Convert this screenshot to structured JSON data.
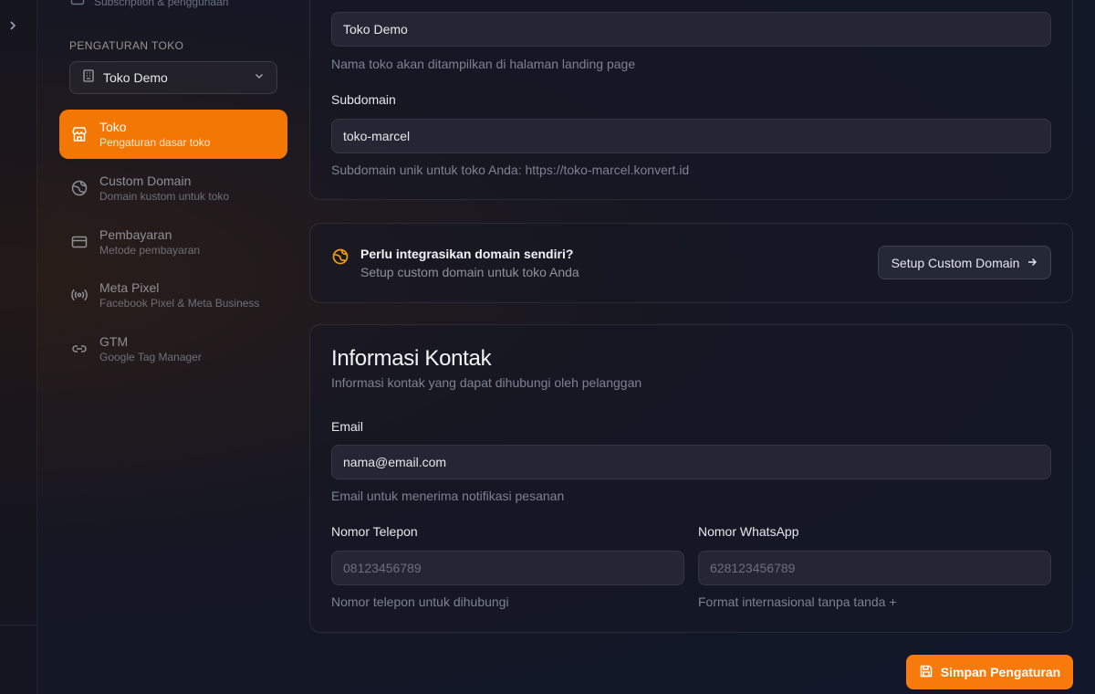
{
  "sidebar": {
    "top_item": {
      "subtitle": "Subscription & penggunaan"
    },
    "section_label": "PENGATURAN TOKO",
    "store_select": {
      "value": "Toko Demo"
    },
    "items": [
      {
        "title": "Toko",
        "subtitle": "Pengaturan dasar toko",
        "icon": "store-icon",
        "active": true
      },
      {
        "title": "Custom Domain",
        "subtitle": "Domain kustom untuk toko",
        "icon": "globe-icon"
      },
      {
        "title": "Pembayaran",
        "subtitle": "Metode pembayaran",
        "icon": "credit-card-icon"
      },
      {
        "title": "Meta Pixel",
        "subtitle": "Facebook Pixel & Meta Business",
        "icon": "radio-icon"
      },
      {
        "title": "GTM",
        "subtitle": "Google Tag Manager",
        "icon": "link-icon"
      }
    ]
  },
  "store_card": {
    "name_value": "Toko Demo",
    "name_help": "Nama toko akan ditampilkan di halaman landing page",
    "subdomain_label": "Subdomain",
    "subdomain_value": "toko-marcel",
    "subdomain_help": "Subdomain unik untuk toko Anda: https://toko-marcel.konvert.id"
  },
  "domain_cta": {
    "title": "Perlu integrasikan domain sendiri?",
    "subtitle": "Setup custom domain untuk toko Anda",
    "button_label": "Setup Custom Domain"
  },
  "contact_card": {
    "title": "Informasi Kontak",
    "subtitle": "Informasi kontak yang dapat dihubungi oleh pelanggan",
    "email_label": "Email",
    "email_value": "nama@email.com",
    "email_help": "Email untuk menerima notifikasi pesanan",
    "phone_label": "Nomor Telepon",
    "phone_placeholder": "08123456789",
    "phone_help": "Nomor telepon untuk dihubungi",
    "whatsapp_label": "Nomor WhatsApp",
    "whatsapp_placeholder": "628123456789",
    "whatsapp_help": "Format internasional tanpa tanda +"
  },
  "save_button": {
    "label": "Simpan Pengaturan"
  },
  "colors": {
    "accent": "#f27705",
    "accent_button": "#f97a0c",
    "cta_icon": "#f59e0b"
  }
}
